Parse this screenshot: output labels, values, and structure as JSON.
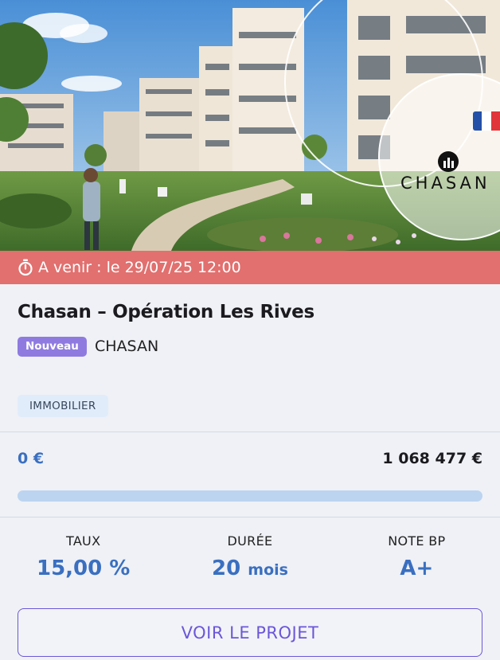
{
  "hero": {
    "logo_text": "CHASAN"
  },
  "status": {
    "text": "A venir : le 29/07/25 12:00"
  },
  "project": {
    "title": "Chasan – Opération Les Rives",
    "badge": "Nouveau",
    "issuer": "CHASAN",
    "category": "IMMOBILIER"
  },
  "funding": {
    "collected": "0 €",
    "target": "1 068 477 €",
    "progress_fraction": 0
  },
  "stats": [
    {
      "label": "TAUX",
      "value": "15,00 %",
      "unit": ""
    },
    {
      "label": "DURÉE",
      "value": "20",
      "unit": "mois"
    },
    {
      "label": "NOTE BP",
      "value": "A+",
      "unit": ""
    }
  ],
  "cta": {
    "label": "VOIR LE PROJET"
  },
  "colors": {
    "status_bg": "#e1706f",
    "badge_bg": "#8f7be0",
    "accent_blue": "#3a6fc0",
    "cta_purple": "#6b57d8"
  }
}
